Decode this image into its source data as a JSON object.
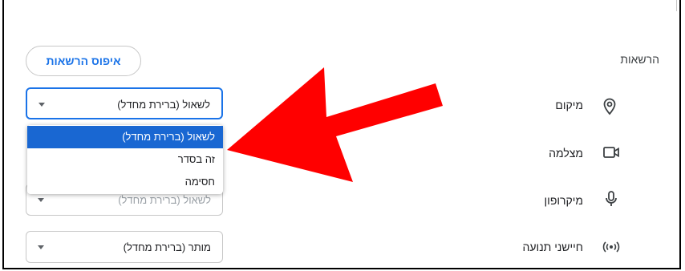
{
  "permissions_section": {
    "title": "הרשאות",
    "reset_button": "איפוס הרשאות"
  },
  "permissions": [
    {
      "label": "מיקום",
      "icon": "location-pin-icon",
      "value": "לשאול (ברירת מחדל)",
      "state": "open"
    },
    {
      "label": "מצלמה",
      "icon": "camera-icon",
      "value": "",
      "state": "hidden"
    },
    {
      "label": "מיקרופון",
      "icon": "microphone-icon",
      "value": "לשאול (ברירת מחדל)",
      "state": "normal"
    },
    {
      "label": "חיישני תנועה",
      "icon": "motion-sensors-icon",
      "value": "מותר (ברירת מחדל)",
      "state": "normal"
    }
  ],
  "dropdown": {
    "options": [
      "לשאול (ברירת מחדל)",
      "זה בסדר",
      "חסימה"
    ],
    "selected_index": 0
  },
  "annotation": {
    "arrow_color": "#ff0000"
  },
  "colors": {
    "accent": "#1a73e8",
    "selected_bg": "#1967d2"
  }
}
